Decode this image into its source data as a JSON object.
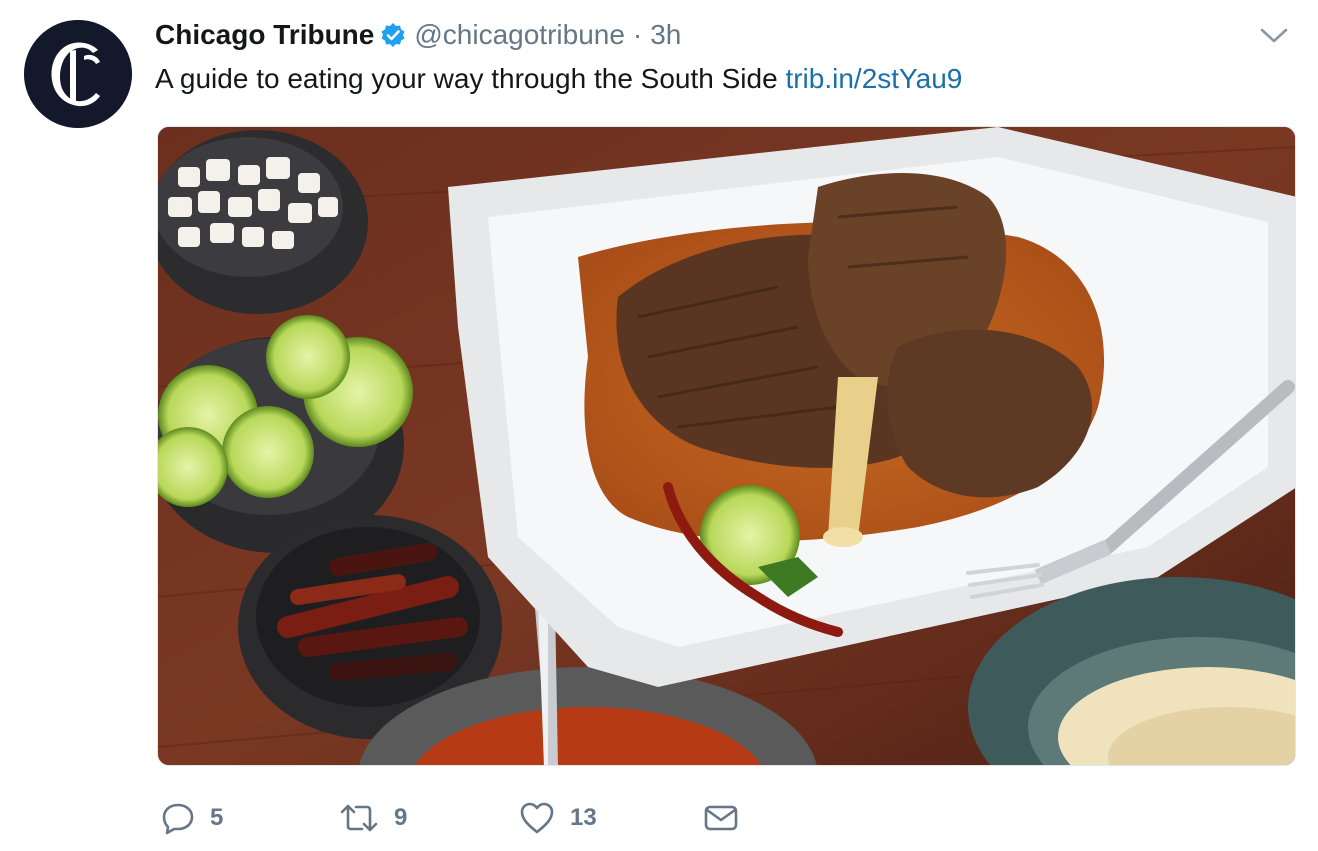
{
  "tweet": {
    "author_name": "Chicago Tribune",
    "handle": "@chicagotribune",
    "separator": "·",
    "time": "3h",
    "text": "A guide to eating your way through the South Side",
    "link": "trib.in/2stYau9",
    "avatar_glyph": "C",
    "media_description_icon": "photo-of-food"
  },
  "actions": {
    "reply_count": "5",
    "retweet_count": "9",
    "like_count": "13"
  },
  "colors": {
    "link": "#1b6fad",
    "verified": "#1da1f2",
    "muted": "#657786",
    "avatar_bg": "#14182b"
  }
}
